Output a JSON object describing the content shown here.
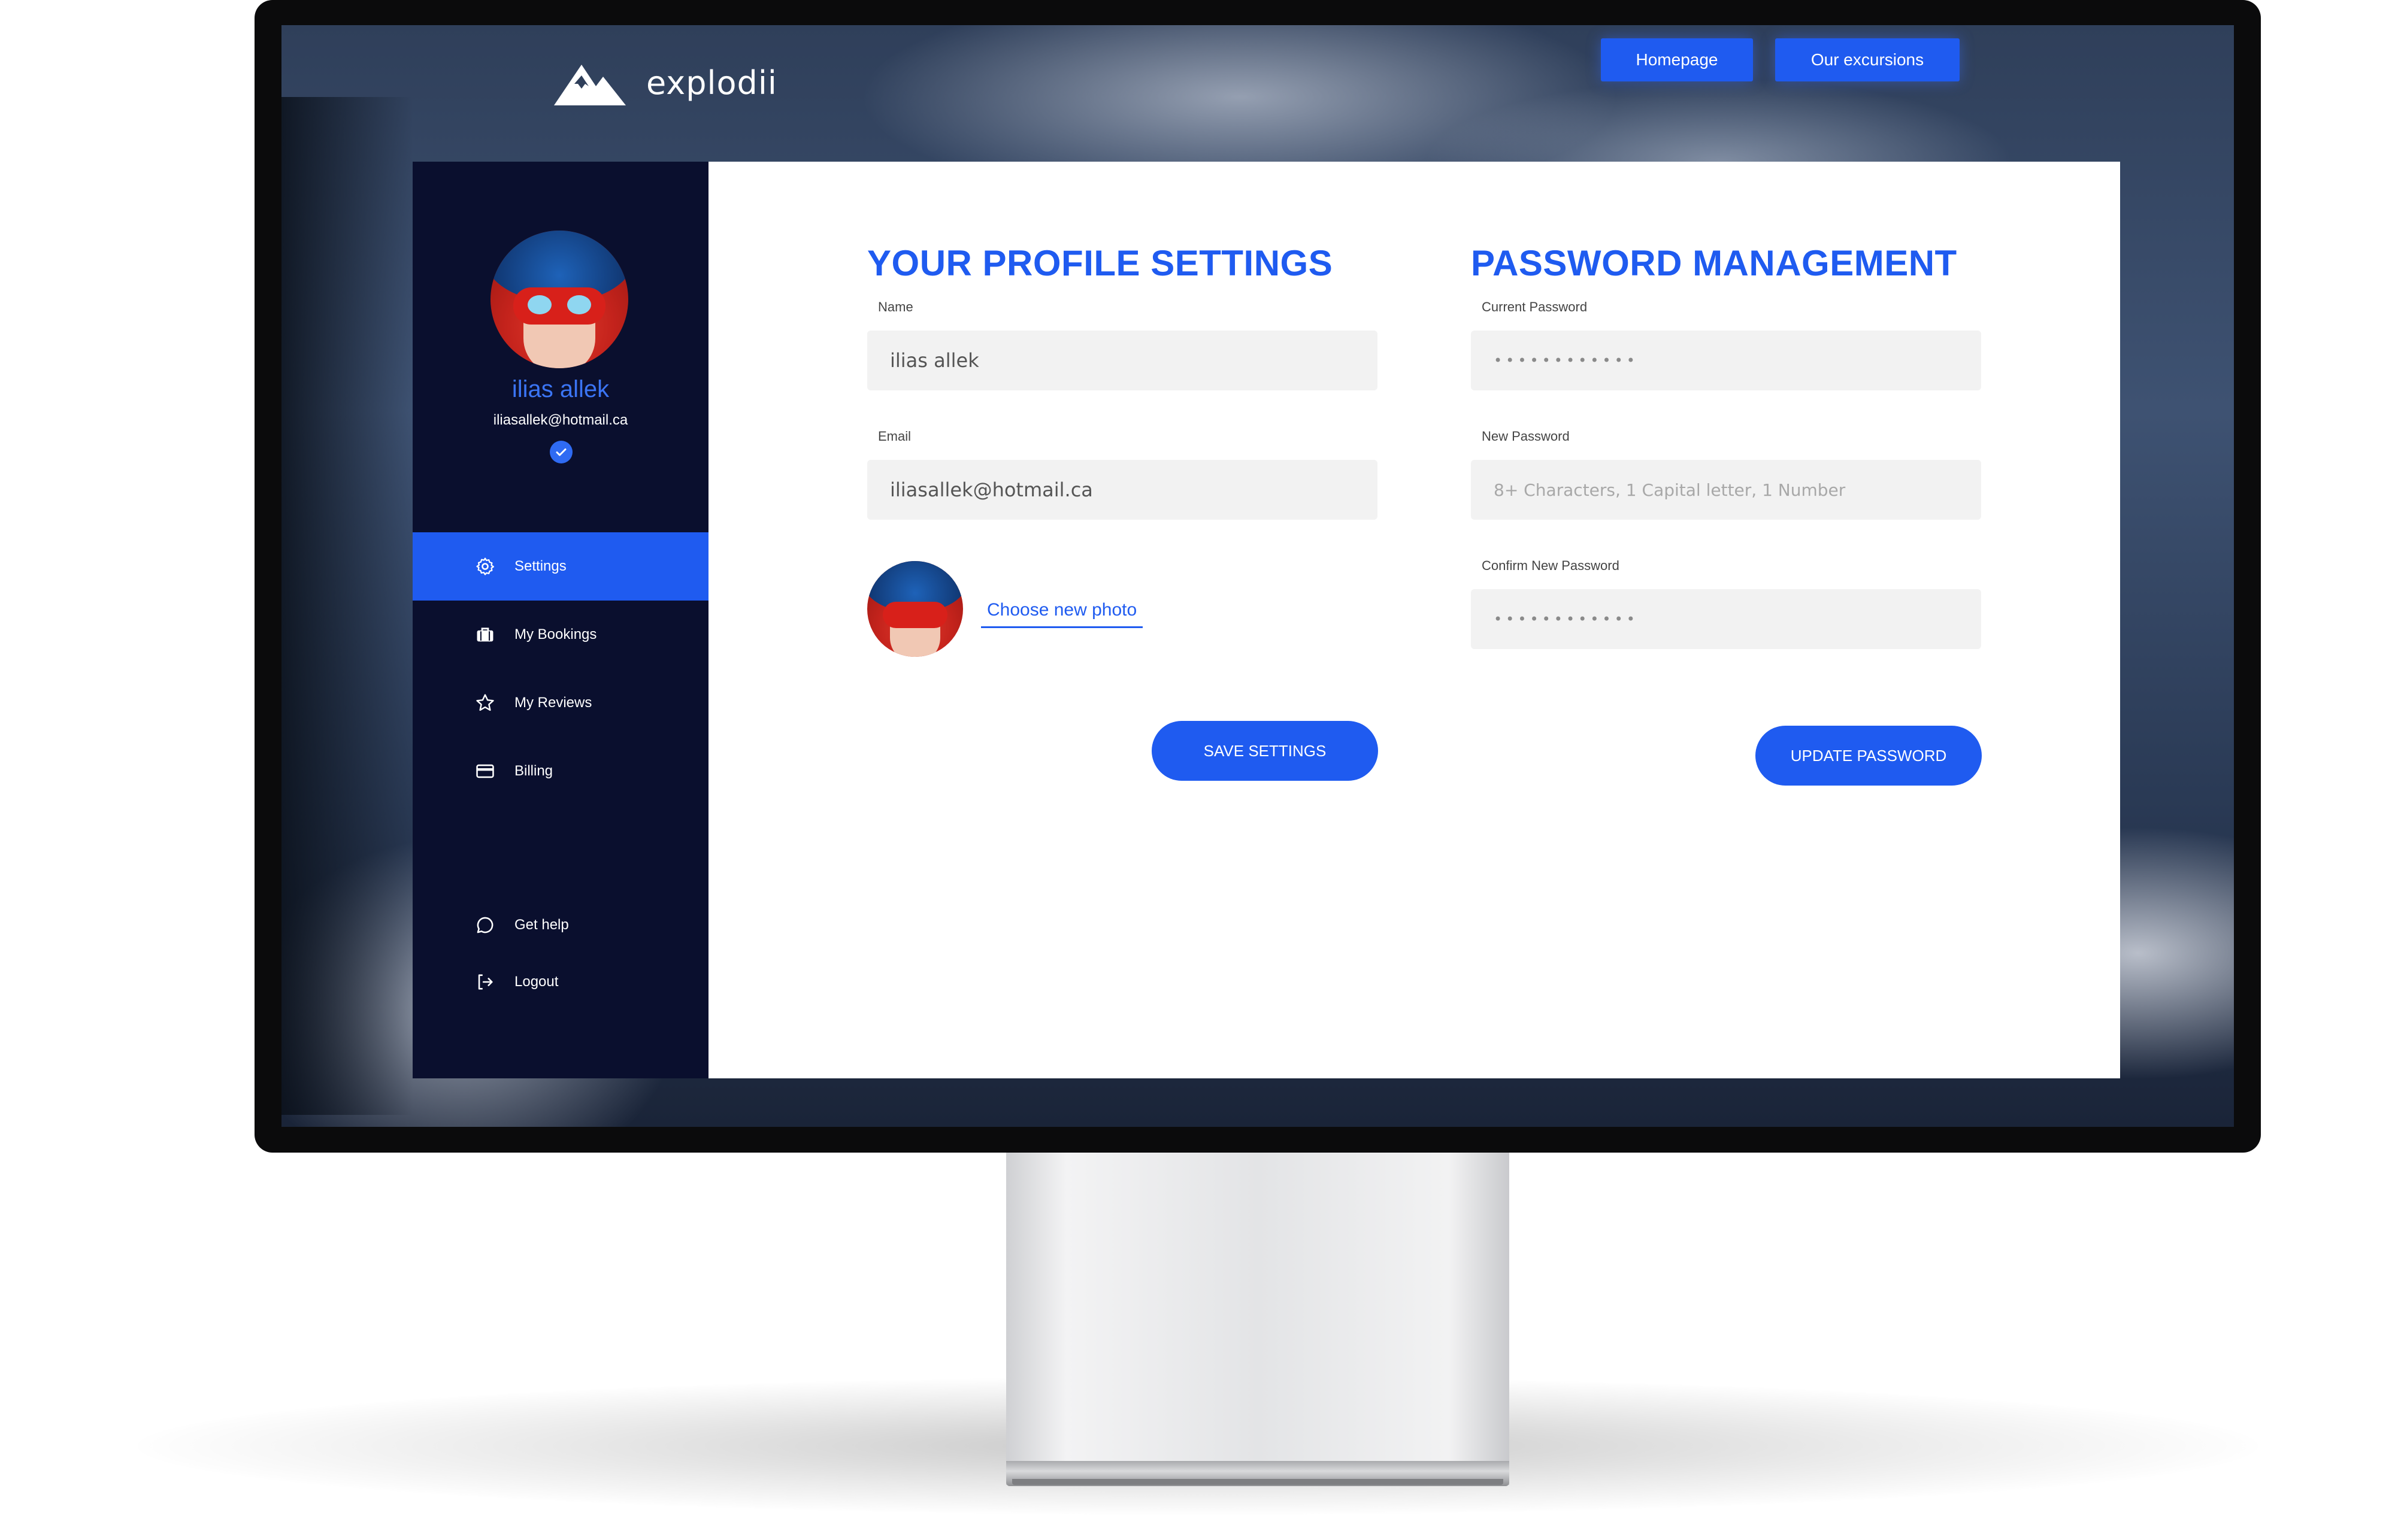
{
  "brand": {
    "name": "explodii"
  },
  "nav": {
    "homepage": "Homepage",
    "excursions": "Our excursions"
  },
  "profile": {
    "name": "ilias allek",
    "email": "iliasallek@hotmail.ca",
    "verified": true
  },
  "sidebar": {
    "items": [
      {
        "label": "Settings",
        "icon": "gear-icon",
        "active": true
      },
      {
        "label": "My Bookings",
        "icon": "briefcase-icon",
        "active": false
      },
      {
        "label": "My Reviews",
        "icon": "star-icon",
        "active": false
      },
      {
        "label": "Billing",
        "icon": "credit-card-icon",
        "active": false
      }
    ],
    "footer": [
      {
        "label": "Get help",
        "icon": "chat-bubble-icon"
      },
      {
        "label": "Logout",
        "icon": "logout-icon"
      }
    ]
  },
  "settings": {
    "title": "YOUR PROFILE SETTINGS",
    "name_label": "Name",
    "name_value": "ilias allek",
    "email_label": "Email",
    "email_value": "iliasallek@hotmail.ca",
    "choose_photo": "Choose new photo",
    "save_button": "SAVE SETTINGS"
  },
  "password": {
    "title": "PASSWORD MANAGEMENT",
    "current_label": "Current Password",
    "current_value": "••••••••••••",
    "new_label": "New Password",
    "new_placeholder": "8+ Characters, 1 Capital letter, 1 Number",
    "confirm_label": "Confirm New Password",
    "confirm_value": "••••••••••••",
    "update_button": "UPDATE PASSWORD"
  },
  "colors": {
    "accent": "#1f5bf0",
    "sidebar": "#0a0f2e",
    "field_bg": "#f2f2f2"
  }
}
